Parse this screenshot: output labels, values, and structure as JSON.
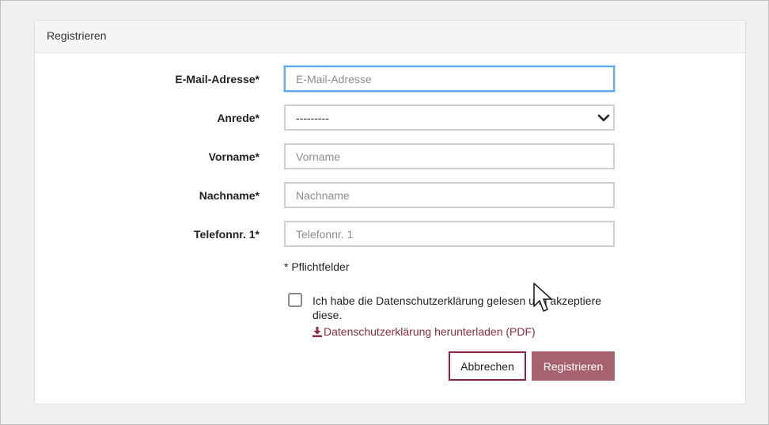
{
  "panel": {
    "title": "Registrieren"
  },
  "form": {
    "email": {
      "label": "E-Mail-Adresse*",
      "placeholder": "E-Mail-Adresse",
      "value": ""
    },
    "salutation": {
      "label": "Anrede*",
      "selected": "---------",
      "icon": "chevron-down-icon"
    },
    "firstname": {
      "label": "Vorname*",
      "placeholder": "Vorname",
      "value": ""
    },
    "lastname": {
      "label": "Nachname*",
      "placeholder": "Nachname",
      "value": ""
    },
    "phone": {
      "label": "Telefonnr. 1*",
      "placeholder": "Telefonnr. 1",
      "value": ""
    },
    "required_hint": "* Pflichtfelder",
    "consent": {
      "checked": false,
      "text": "Ich habe die Datenschutzerklärung gelesen und akzeptiere diese.",
      "link_label": "Datenschutzerklärung herunterladen (PDF)",
      "link_icon": "download-icon"
    }
  },
  "buttons": {
    "cancel_label": "Abbrechen",
    "submit_label": "Registrieren"
  },
  "colors": {
    "focus_border": "#62a9f5",
    "link": "#8c2c3c",
    "cancel_border": "#8c2438",
    "submit_bg": "#a6636e"
  }
}
